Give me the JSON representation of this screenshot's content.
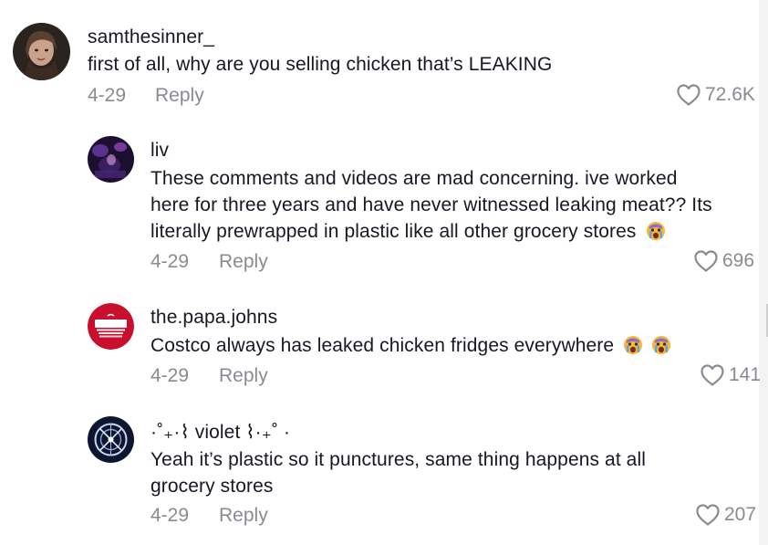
{
  "comments": [
    {
      "username": "samthesinner_",
      "text": "first of all, why are you selling chicken that’s LEAKING",
      "date": "4-29",
      "reply_label": "Reply",
      "likes": "72.6K"
    },
    {
      "username": "liv",
      "text_lines": [
        "These comments and videos are mad concerning. ive worked",
        "here for three years and have never witnessed leaking meat?? Its",
        "literally prewrapped in plastic like all other grocery stores"
      ],
      "date": "4-29",
      "reply_label": "Reply",
      "likes": "696"
    },
    {
      "username": "the.papa.johns",
      "text": "Costco always has leaked chicken fridges everywhere",
      "avatar_text": "PAPA JOHNS",
      "date": "4-29",
      "reply_label": "Reply",
      "likes": "141"
    },
    {
      "username": "·˚₊·⌇ violet ⌇·₊˚ ·",
      "text_lines": [
        "Yeah it’s plastic so it punctures, same thing happens at all",
        "grocery stores"
      ],
      "date": "4-29",
      "reply_label": "Reply",
      "likes": "207"
    }
  ],
  "icons": {
    "like": "heart-outline-icon",
    "emoji": "crying-face-emoji"
  },
  "colors": {
    "text": "#161823",
    "muted": "#8a8b91",
    "papa_red": "#c8102e"
  }
}
